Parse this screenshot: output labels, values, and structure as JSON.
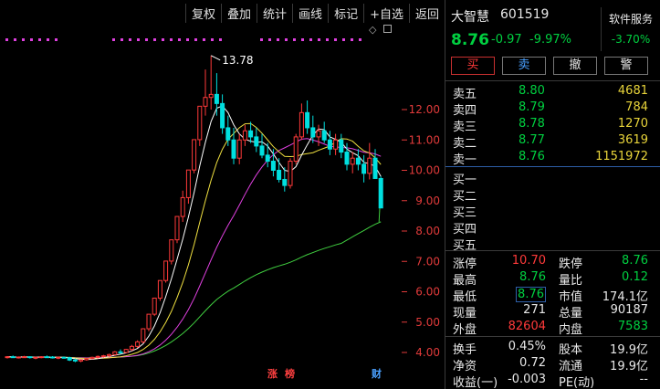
{
  "toolbar": {
    "fuquan": "复权",
    "diejia": "叠加",
    "tongji": "统计",
    "huaxian": "画线",
    "biaoji": "标记",
    "zixuan": "+自选",
    "fanhui": "返回"
  },
  "chart": {
    "peak_label": "13.78",
    "flags": {
      "zhang": "涨",
      "bang": "榜",
      "cai": "财"
    },
    "icons": [
      "diamond-icon",
      "window-icon"
    ]
  },
  "chart_data": {
    "type": "candlestick",
    "price_axis_ticks": [
      "12.00",
      "11.00",
      "10.00",
      "9.00",
      "8.00",
      "7.00",
      "6.00",
      "5.00",
      "4.00"
    ],
    "peak_high": 13.78,
    "last_close": 8.76,
    "colors": {
      "up": "#ff3a3a",
      "down": "#00e0e0",
      "ma5": "#ffffff",
      "ma10": "#f0e040",
      "ma20": "#e040e0",
      "ma60": "#40d040",
      "axis": "#e03a3a"
    },
    "candles": [
      [
        3.85,
        3.88,
        3.8,
        3.86
      ],
      [
        3.86,
        3.9,
        3.82,
        3.84
      ],
      [
        3.84,
        3.87,
        3.8,
        3.85
      ],
      [
        3.85,
        3.89,
        3.82,
        3.86
      ],
      [
        3.86,
        3.88,
        3.8,
        3.83
      ],
      [
        3.83,
        3.86,
        3.78,
        3.84
      ],
      [
        3.84,
        3.88,
        3.81,
        3.86
      ],
      [
        3.86,
        3.9,
        3.83,
        3.85
      ],
      [
        3.85,
        3.88,
        3.8,
        3.82
      ],
      [
        3.82,
        3.86,
        3.78,
        3.84
      ],
      [
        3.84,
        3.87,
        3.8,
        3.83
      ],
      [
        3.83,
        3.86,
        3.72,
        3.75
      ],
      [
        3.75,
        3.8,
        3.68,
        3.72
      ],
      [
        3.72,
        3.78,
        3.68,
        3.76
      ],
      [
        3.76,
        3.82,
        3.73,
        3.8
      ],
      [
        3.8,
        3.86,
        3.77,
        3.84
      ],
      [
        3.84,
        3.9,
        3.8,
        3.87
      ],
      [
        3.87,
        3.92,
        3.83,
        3.89
      ],
      [
        3.89,
        3.96,
        3.85,
        3.93
      ],
      [
        3.93,
        4.05,
        3.9,
        4.02
      ],
      [
        4.02,
        4.1,
        3.96,
        4.0
      ],
      [
        4.0,
        4.12,
        3.98,
        4.1
      ],
      [
        4.1,
        4.25,
        4.05,
        4.2
      ],
      [
        4.2,
        4.4,
        4.15,
        4.35
      ],
      [
        4.35,
        4.8,
        4.3,
        4.78
      ],
      [
        4.78,
        5.26,
        4.7,
        5.26
      ],
      [
        5.26,
        5.79,
        5.2,
        5.79
      ],
      [
        5.79,
        6.37,
        5.7,
        6.37
      ],
      [
        6.37,
        7.01,
        6.3,
        7.01
      ],
      [
        7.01,
        7.71,
        6.9,
        7.71
      ],
      [
        7.71,
        8.48,
        7.6,
        8.48
      ],
      [
        8.48,
        9.33,
        8.3,
        9.1
      ],
      [
        9.1,
        10.01,
        8.9,
        10.01
      ],
      [
        10.01,
        11.01,
        9.9,
        11.01
      ],
      [
        11.01,
        12.11,
        10.8,
        12.11
      ],
      [
        12.11,
        13.32,
        11.8,
        12.4
      ],
      [
        12.4,
        13.78,
        12.0,
        12.5
      ],
      [
        12.5,
        13.2,
        11.8,
        12.2
      ],
      [
        12.2,
        12.5,
        11.2,
        11.4
      ],
      [
        11.4,
        11.8,
        10.8,
        11.0
      ],
      [
        11.0,
        11.4,
        10.2,
        10.4
      ],
      [
        10.4,
        11.2,
        10.2,
        11.0
      ],
      [
        11.0,
        11.5,
        10.8,
        11.3
      ],
      [
        11.3,
        11.6,
        10.9,
        11.1
      ],
      [
        11.1,
        11.4,
        10.6,
        10.8
      ],
      [
        10.8,
        11.2,
        10.4,
        10.5
      ],
      [
        10.5,
        10.9,
        10.1,
        10.3
      ],
      [
        10.3,
        10.7,
        9.8,
        10.0
      ],
      [
        10.0,
        10.4,
        9.6,
        9.7
      ],
      [
        9.7,
        10.1,
        9.3,
        9.5
      ],
      [
        9.5,
        10.4,
        9.4,
        10.3
      ],
      [
        10.3,
        11.2,
        10.2,
        11.1
      ],
      [
        11.1,
        12.2,
        11.0,
        11.9
      ],
      [
        11.9,
        12.3,
        11.2,
        11.4
      ],
      [
        11.4,
        11.8,
        10.9,
        11.1
      ],
      [
        11.1,
        11.5,
        10.8,
        11.3
      ],
      [
        11.3,
        11.6,
        10.9,
        11.0
      ],
      [
        11.0,
        11.3,
        10.5,
        10.7
      ],
      [
        10.7,
        11.2,
        10.5,
        11.0
      ],
      [
        11.0,
        11.2,
        10.4,
        10.6
      ],
      [
        10.6,
        10.9,
        10.0,
        10.2
      ],
      [
        10.2,
        10.6,
        9.9,
        10.4
      ],
      [
        10.4,
        10.7,
        10.0,
        10.2
      ],
      [
        10.2,
        10.5,
        9.6,
        9.9
      ],
      [
        9.9,
        10.9,
        9.7,
        10.4
      ],
      [
        10.4,
        10.7,
        9.8,
        9.73
      ],
      [
        9.73,
        9.8,
        8.76,
        8.76
      ]
    ]
  },
  "quote": {
    "name": "大智慧",
    "code": "601519",
    "sector": "软件服务",
    "sector_pct": "-3.70%",
    "price": "8.76",
    "change": "-0.97",
    "change_pct": "-9.97%",
    "buttons": {
      "buy": "买",
      "sell": "卖",
      "cancel": "撤",
      "alert": "警"
    },
    "asks": [
      {
        "label": "卖五",
        "price": "8.80",
        "vol": "4681"
      },
      {
        "label": "卖四",
        "price": "8.79",
        "vol": "784"
      },
      {
        "label": "卖三",
        "price": "8.78",
        "vol": "1270"
      },
      {
        "label": "卖二",
        "price": "8.77",
        "vol": "3619"
      },
      {
        "label": "卖一",
        "price": "8.76",
        "vol": "1151972"
      }
    ],
    "bids": [
      {
        "label": "买一"
      },
      {
        "label": "买二"
      },
      {
        "label": "买三"
      },
      {
        "label": "买四"
      },
      {
        "label": "买五"
      }
    ],
    "stats1": [
      {
        "l1": "涨停",
        "v1": "10.70",
        "c1": "red",
        "l2": "跌停",
        "v2": "8.76",
        "c2": "green"
      },
      {
        "l1": "最高",
        "v1": "8.76",
        "c1": "green",
        "l2": "量比",
        "v2": "0.12",
        "c2": "green"
      },
      {
        "l1": "最低",
        "v1": "8.76",
        "c1": "green",
        "l2": "市值",
        "v2": "174.1亿",
        "c2": "white"
      },
      {
        "l1": "现量",
        "v1": "271",
        "c1": "white",
        "l2": "总量",
        "v2": "90187",
        "c2": "white"
      },
      {
        "l1": "外盘",
        "v1": "82604",
        "c1": "red",
        "l2": "内盘",
        "v2": "7583",
        "c2": "green"
      }
    ],
    "stats2": [
      {
        "l1": "换手",
        "v1": "0.45%",
        "l2": "股本",
        "v2": "19.9亿"
      },
      {
        "l1": "净资",
        "v1": "0.72",
        "l2": "流通",
        "v2": "19.9亿"
      },
      {
        "l1": "收益(一)",
        "v1": "-0.003",
        "l2": "PE(动)",
        "v2": "--"
      }
    ]
  }
}
